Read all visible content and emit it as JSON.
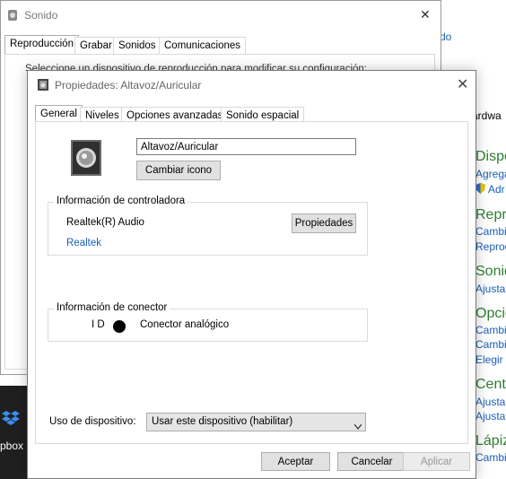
{
  "background": {
    "fragments": {
      "panel_link": "do",
      "hardware": "ardwa",
      "dispositivos_heading": "Dispo",
      "agregar_link": "Agrega",
      "admin_link": "Adr",
      "reproduccion_heading": "Repro",
      "cambiar_link_1": "Cambi",
      "reproduccion_link": "Reprod",
      "sonido_heading": "Sonido",
      "ajustar_link_1": "Ajustar",
      "opciones_heading": "Opcio",
      "cambiar_link_2": "Cambi",
      "cambiar_link_3": "Cambi",
      "elegir_link": "Elegir u",
      "centro_heading": "Centr",
      "ajustar_link_2": "Ajustar",
      "ajustar_link_3": "Ajustar",
      "lapiz_heading": "Lápiz",
      "cambiar_link_4": "Cambi"
    },
    "taskbar_label": "pbox"
  },
  "sonido_window": {
    "title": "Sonido",
    "tabs": [
      "Reproducción",
      "Grabar",
      "Sonidos",
      "Comunicaciones"
    ],
    "active_tab": "Reproducción",
    "partial_text": "Seleccione un dispositivo de reproducción para modificar su configuración:"
  },
  "properties_window": {
    "title": "Propiedades: Altavoz/Auricular",
    "tabs": [
      "General",
      "Niveles",
      "Opciones avanzadas",
      "Sonido espacial"
    ],
    "active_tab": "General",
    "device_name": "Altavoz/Auricular",
    "change_icon_label": "Cambiar icono",
    "controller_group": {
      "label": "Información de controladora",
      "driver": "Realtek(R) Audio",
      "properties_button": "Propiedades",
      "vendor_link": "Realtek"
    },
    "connector_group": {
      "label": "Información de conector",
      "id_label": "I D",
      "connector_label": "Conector analógico",
      "jack_color": "#000000"
    },
    "usage": {
      "label": "Uso de dispositivo:",
      "selected": "Usar este dispositivo (habilitar)"
    },
    "buttons": {
      "accept": "Aceptar",
      "cancel": "Cancelar",
      "apply": "Aplicar"
    }
  }
}
